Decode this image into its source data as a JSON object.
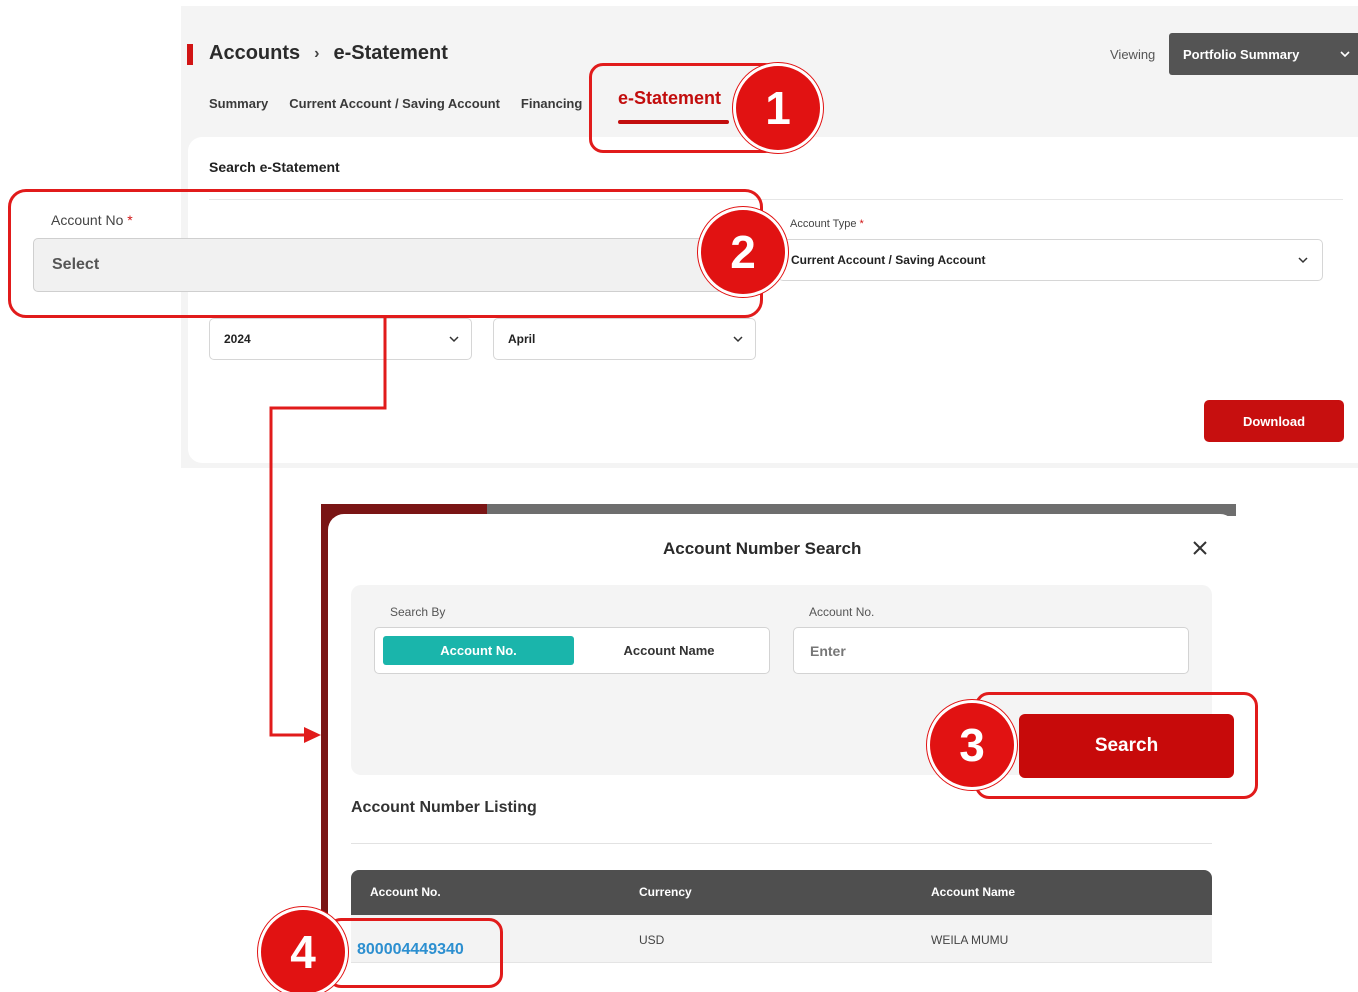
{
  "header": {
    "breadcrumb_root": "Accounts",
    "breadcrumb_separator": "›",
    "breadcrumb_current": "e-Statement",
    "viewing_label": "Viewing",
    "portfolio_value": "Portfolio Summary"
  },
  "tabs": [
    {
      "label": "Summary"
    },
    {
      "label": "Current Account / Saving Account"
    },
    {
      "label": "Financing"
    },
    {
      "label": "e-Statement",
      "active": true
    }
  ],
  "search_card": {
    "title": "Search e-Statement",
    "account_no_label": "Account No",
    "required_mark": "*",
    "account_no_value": "Select",
    "account_type_label": "Account Type",
    "account_type_value": "Current Account / Saving Account",
    "year_value": "2024",
    "month_value": "April",
    "download_label": "Download"
  },
  "modal": {
    "title": "Account Number Search",
    "search_by_label": "Search By",
    "toggle_account_no": "Account No.",
    "toggle_account_name": "Account Name",
    "account_no_field_label": "Account No.",
    "account_no_placeholder": "Enter",
    "search_label": "Search",
    "listing_title": "Account Number Listing",
    "table": {
      "columns": [
        "Account No.",
        "Currency",
        "Account Name"
      ],
      "rows": [
        {
          "account_no": "800004449340",
          "currency": "USD",
          "account_name": "WEILA MUMU"
        }
      ]
    }
  },
  "callouts": {
    "step1": "1",
    "step2": "2",
    "step3": "3",
    "step4": "4"
  },
  "colors": {
    "brand_red": "#c70f0f",
    "callout_red": "#e11212",
    "teal_toggle": "#1ab5ab",
    "link_blue": "#2c8fd0",
    "table_header": "#4f4f4f"
  }
}
